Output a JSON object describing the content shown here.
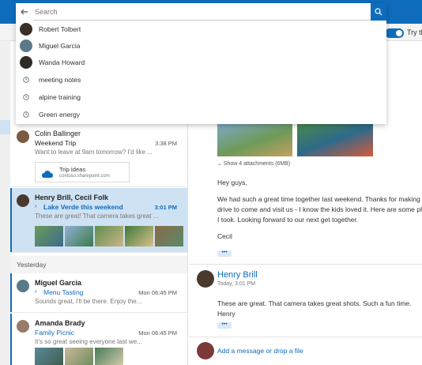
{
  "search": {
    "placeholder": "Search",
    "suggestions": [
      {
        "type": "person",
        "label": "Robert Tolbert"
      },
      {
        "type": "person",
        "label": "Miguel Garcia"
      },
      {
        "type": "person",
        "label": "Wanda Howard"
      },
      {
        "type": "history",
        "label": "meeting notes"
      },
      {
        "type": "history",
        "label": "alpine training"
      },
      {
        "type": "history",
        "label": "Green energy"
      }
    ]
  },
  "header": {
    "toggle_label": "Try th",
    "toggle_on": true
  },
  "messages": [
    {
      "from": "Colin Ballinger",
      "subject": "Weekend Trip",
      "time": "3:38 PM",
      "preview": "Want to leave at 9am tomorrow? I'd like ...",
      "attachment": {
        "title": "Trip Ideas",
        "url": "contoso.sharepoint.com"
      }
    },
    {
      "from": "Henry Brill, Cecil Folk",
      "subject": "Lake Verde this weekend",
      "time": "3:01 PM",
      "preview": "These are great! That camera takes great ...",
      "selected": true
    },
    {
      "from": "Miguel Garcia",
      "subject": "Menu Tasting",
      "time": "Mon 06:45 PM",
      "preview": "Sounds great, I'll be there. Enjoy the..."
    },
    {
      "from": "Amanda Brady",
      "subject": "Family Picnic",
      "time": "Mon 06:45 PM",
      "preview": "It's so great seeing everyone last we..."
    }
  ],
  "groups": {
    "yesterday": "Yesterday"
  },
  "reading": {
    "attachments_link": "Show 4 attachments (6MB)",
    "greeting": "Hey guys,",
    "body": [
      "We had such a great time together last weekend. Thanks for making the",
      "drive to come and visit us - I know the kids loved it. Here are some ph",
      "I took. Looking forward to our next get together."
    ],
    "signature": "Cecil",
    "more": "•••",
    "reply": {
      "name": "Henry Brill",
      "date": "Today, 3:01 PM",
      "body": "These are great. That camera takes great shots. Such a fun time.",
      "signature": "Henry"
    },
    "compose_placeholder": "Add a message or drop a file"
  },
  "colors": {
    "accent": "#0f6cbd",
    "selected_row": "#cfe2f3"
  }
}
